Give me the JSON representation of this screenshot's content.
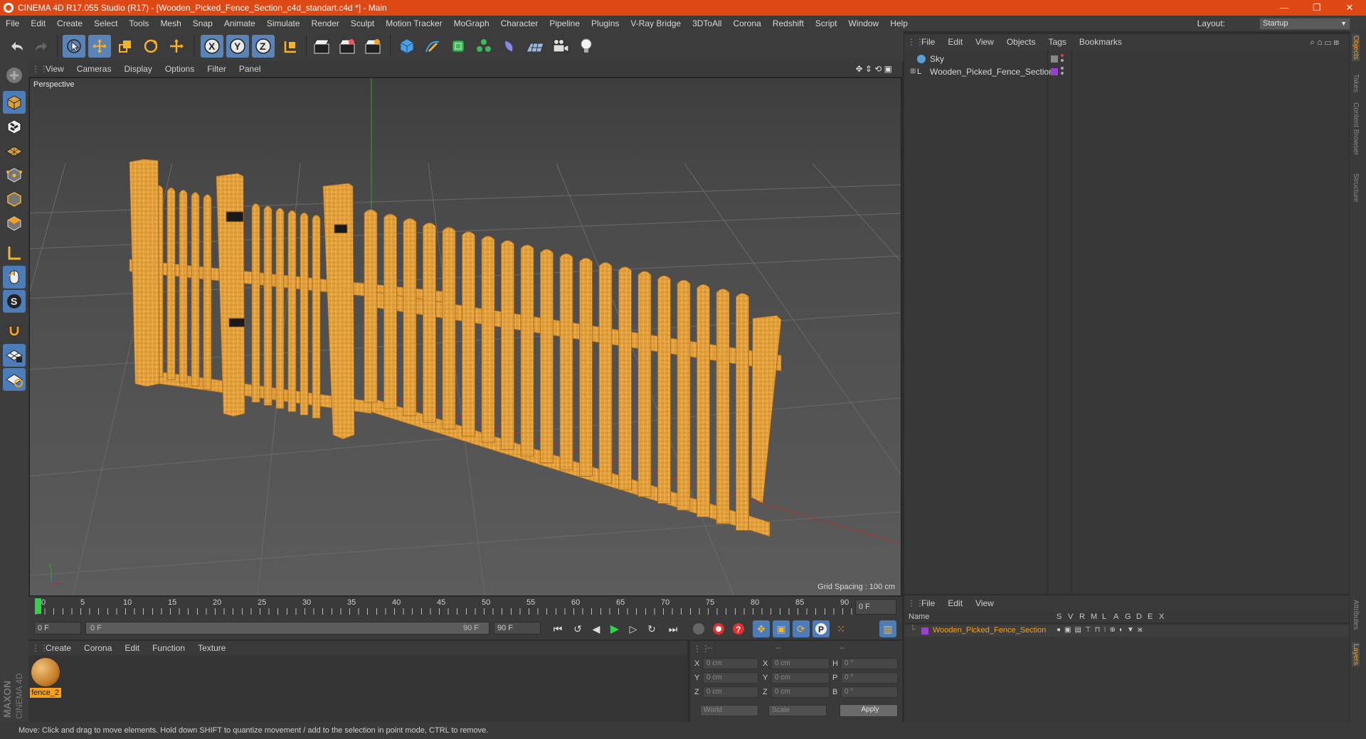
{
  "window": {
    "title": "CINEMA 4D R17.055 Studio (R17) - [Wooden_Picked_Fence_Section_c4d_standart.c4d *] - Main",
    "controls": [
      "—",
      "❐",
      "✕"
    ]
  },
  "menubar": {
    "items": [
      "File",
      "Edit",
      "Create",
      "Select",
      "Tools",
      "Mesh",
      "Snap",
      "Animate",
      "Simulate",
      "Render",
      "Sculpt",
      "Motion Tracker",
      "MoGraph",
      "Character",
      "Pipeline",
      "Plugins",
      "V-Ray Bridge",
      "3DToAll",
      "Corona",
      "Redshift",
      "Script",
      "Window",
      "Help"
    ],
    "layout_label": "Layout:",
    "layout_value": "Startup"
  },
  "viewport": {
    "menu": [
      "View",
      "Cameras",
      "Display",
      "Options",
      "Filter",
      "Panel"
    ],
    "label": "Perspective",
    "grid_spacing": "Grid Spacing : 100 cm"
  },
  "timeline": {
    "ticks": [
      "0",
      "5",
      "10",
      "15",
      "20",
      "25",
      "30",
      "35",
      "40",
      "45",
      "50",
      "55",
      "60",
      "65",
      "70",
      "75",
      "80",
      "85",
      "90"
    ],
    "current_frame": "0 F"
  },
  "transport": {
    "start": "0 F",
    "slider_start": "0 F",
    "slider_end": "90 F",
    "end": "90 F"
  },
  "materials": {
    "menu": [
      "Create",
      "Corona",
      "Edit",
      "Function",
      "Texture"
    ],
    "items": [
      {
        "name": "fence_2"
      }
    ]
  },
  "coordinates": {
    "headers": [
      "--",
      "--",
      "--"
    ],
    "rows": [
      {
        "a": "X",
        "av": "0 cm",
        "b": "X",
        "bv": "0 cm",
        "c": "H",
        "cv": "0 °"
      },
      {
        "a": "Y",
        "av": "0 cm",
        "b": "Y",
        "bv": "0 cm",
        "c": "P",
        "cv": "0 °"
      },
      {
        "a": "Z",
        "av": "0 cm",
        "b": "Z",
        "bv": "0 cm",
        "c": "B",
        "cv": "0 °"
      }
    ],
    "world": "World",
    "scale": "Scale",
    "apply": "Apply"
  },
  "objects": {
    "menu": [
      "File",
      "Edit",
      "View",
      "Objects",
      "Tags",
      "Bookmarks"
    ],
    "items": [
      {
        "name": "Sky",
        "color": "#5a9fd4"
      },
      {
        "name": "Wooden_Picked_Fence_Section",
        "color": "#9a3fd0"
      }
    ]
  },
  "layers": {
    "menu": [
      "File",
      "Edit",
      "View"
    ],
    "header_name": "Name",
    "header_cols": [
      "S",
      "V",
      "R",
      "M",
      "L",
      "A",
      "G",
      "D",
      "E",
      "X"
    ],
    "items": [
      {
        "name": "Wooden_Picked_Fence_Section",
        "color": "#9a3fd0"
      }
    ]
  },
  "right_tabs": [
    "Objects",
    "Takes",
    "Content Browser",
    "Structure",
    "Attributes",
    "Layers"
  ],
  "brand": [
    "MAXON",
    "CINEMA 4D"
  ],
  "status": "Move: Click and drag to move elements. Hold down SHIFT to quantize movement / add to the selection in point mode, CTRL to remove.",
  "colors": {
    "accent": "#dd4814",
    "selection": "#5a84b8",
    "wood": "#e2a03c"
  }
}
